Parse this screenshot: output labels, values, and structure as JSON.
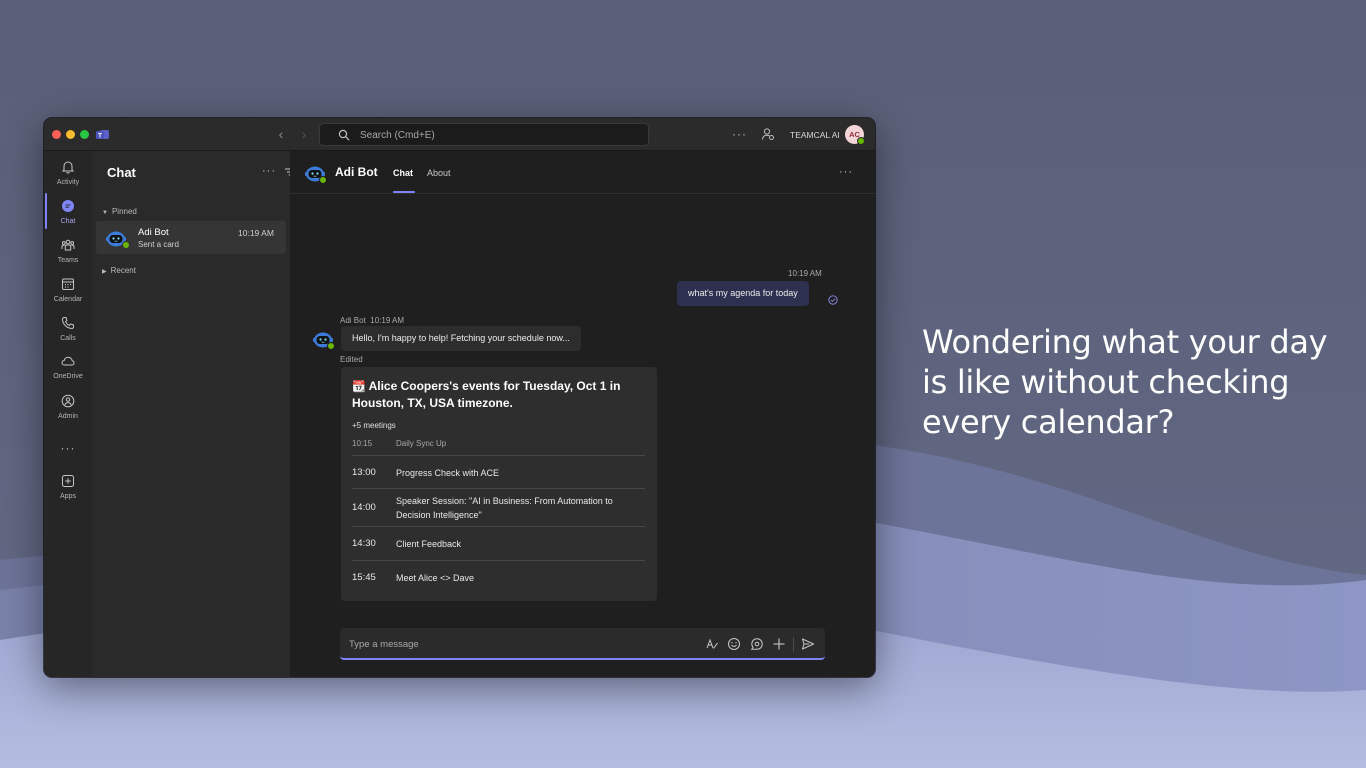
{
  "marketing": {
    "tagline": "Wondering what your day is like without checking every calendar?"
  },
  "titlebar": {
    "search_placeholder": "Search (Cmd+E)",
    "org_name": "TEAMCAL AI",
    "user_initials": "AC"
  },
  "rail": {
    "items": [
      {
        "label": "Activity",
        "icon": "bell-icon"
      },
      {
        "label": "Chat",
        "icon": "chat-icon"
      },
      {
        "label": "Teams",
        "icon": "teams-icon"
      },
      {
        "label": "Calendar",
        "icon": "calendar-icon"
      },
      {
        "label": "Calls",
        "icon": "phone-icon"
      },
      {
        "label": "OneDrive",
        "icon": "cloud-icon"
      },
      {
        "label": "Admin",
        "icon": "admin-icon"
      },
      {
        "label": "Apps",
        "icon": "apps-icon"
      }
    ],
    "more": "···"
  },
  "chatlist": {
    "title": "Chat",
    "sections": {
      "pinned": "Pinned",
      "recent": "Recent"
    },
    "pinned_chat": {
      "name": "Adi Bot",
      "preview": "Sent a card",
      "time": "10:19 AM"
    }
  },
  "conversation": {
    "name": "Adi Bot",
    "tabs": [
      {
        "label": "Chat",
        "active": true
      },
      {
        "label": "About",
        "active": false
      }
    ],
    "outgoing": {
      "time": "10:19 AM",
      "text": "what's my agenda for today"
    },
    "incoming": {
      "sender": "Adi Bot",
      "time": "10:19 AM",
      "text": "Hello, I'm happy to help! Fetching your schedule now...",
      "edited_label": "Edited"
    },
    "card": {
      "emoji": "📆",
      "title": "Alice Coopers's events for Tuesday, Oct 1 in Houston, TX, USA timezone.",
      "more_meetings": "+5 meetings",
      "meetings": [
        {
          "time": "10:15",
          "name": "Daily Sync Up",
          "dim": true
        },
        {
          "time": "13:00",
          "name": "Progress Check with ACE",
          "dim": false
        },
        {
          "time": "14:00",
          "name": "Speaker Session: \"AI in Business: From Automation to Decision Intelligence\"",
          "dim": false
        },
        {
          "time": "14:30",
          "name": "Client Feedback",
          "dim": false
        },
        {
          "time": "15:45",
          "name": "Meet Alice <> Dave",
          "dim": false
        }
      ]
    },
    "compose_placeholder": "Type a message"
  },
  "colors": {
    "accent": "#7f85f5",
    "presence": "#6bb700",
    "background": "#585d74"
  }
}
